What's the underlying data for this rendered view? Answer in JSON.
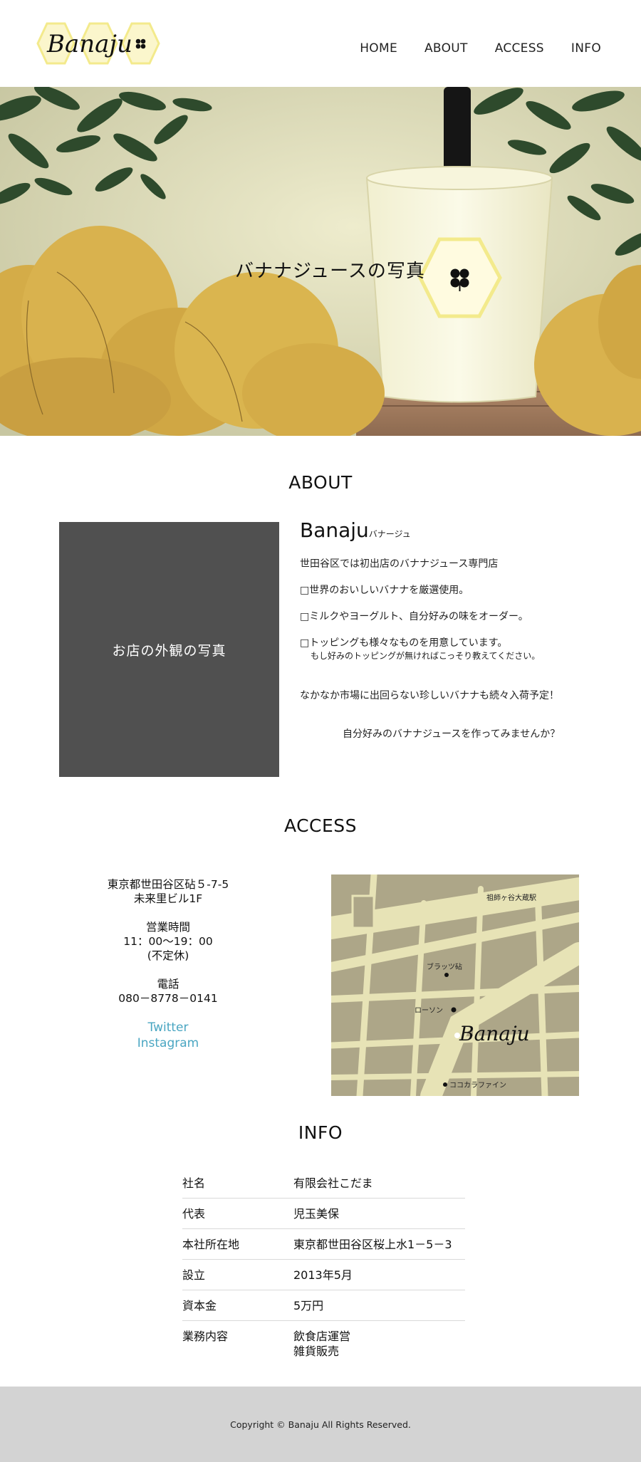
{
  "header": {
    "logo_text": "Banaju",
    "nav": [
      {
        "label": "HOME"
      },
      {
        "label": "ABOUT"
      },
      {
        "label": "ACCESS"
      },
      {
        "label": "INFO"
      }
    ]
  },
  "hero": {
    "caption": "バナナジュースの写真"
  },
  "about": {
    "title": "ABOUT",
    "photo_placeholder": "お店の外観の写真",
    "brand": "Banaju",
    "brand_kana": "バナージュ",
    "lines": [
      "世田谷区では初出店のバナナジュース専門店",
      "□世界のおいしいバナナを厳選使用。",
      "□ミルクやヨーグルト、自分好みの味をオーダー。",
      "□トッピングも様々なものを用意しています。",
      "もし好みのトッピングが無ければこっそり教えてください。",
      "なかなか市場に出回らない珍しいバナナも続々入荷予定！",
      "自分好みのバナナジュースを作ってみませんか？"
    ]
  },
  "access": {
    "title": "ACCESS",
    "address_line1": "東京都世田谷区砧５-7-5",
    "address_line2": "未来里ビル1F",
    "hours_label": "営業時間",
    "hours": "11：00〜19：00",
    "hours_note": "(不定休)",
    "phone_label": "電話",
    "phone": "080－8778－0141",
    "links": [
      {
        "label": "Twitter"
      },
      {
        "label": "Instagram"
      }
    ],
    "map": {
      "station": "祖師ヶ谷大蔵駅",
      "landmark1": "ブラッツ砧",
      "landmark2": "ローソン",
      "landmark3": "ココカラファイン",
      "shop": "Banaju"
    }
  },
  "info": {
    "title": "INFO",
    "rows": [
      {
        "label": "社名",
        "value": "有限会社こだま"
      },
      {
        "label": "代表",
        "value": "児玉美保"
      },
      {
        "label": "本社所在地",
        "value": "東京都世田谷区桜上水1－5－3"
      },
      {
        "label": "設立",
        "value": "2013年5月"
      },
      {
        "label": "資本金",
        "value": "5万円"
      },
      {
        "label": "業務内容",
        "value": "飲食店運営",
        "value2": "雑貨販売"
      }
    ]
  },
  "footer": {
    "copyright": "Copyright © Banaju All Rights Reserved."
  },
  "colors": {
    "accent_yellow": "#f3ea8c",
    "leaf_green": "#2e4a2c",
    "banana": "#d9b24e",
    "link_blue": "#4aa6c2",
    "map_dark": "#ada688",
    "map_light": "#e7e3b6",
    "photo_box": "#505050",
    "footer_bg": "#d3d3d3"
  }
}
